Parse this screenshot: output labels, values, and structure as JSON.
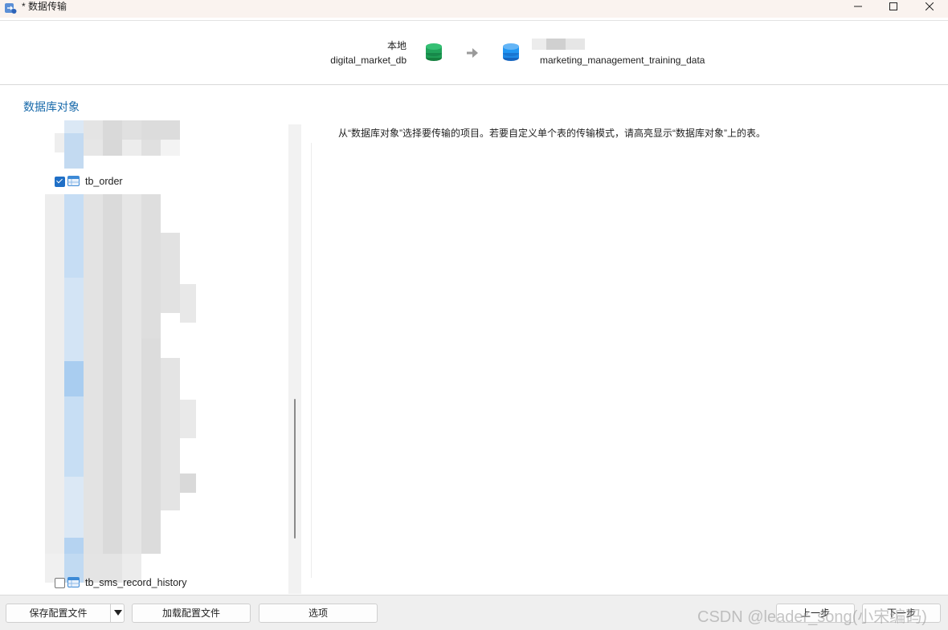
{
  "window": {
    "title": "* 数据传输",
    "app_icon": "navicat-transfer-icon",
    "controls": [
      "minimize-icon",
      "maximize-icon",
      "close-icon"
    ]
  },
  "connection": {
    "source_name": "本地",
    "source_database": "digital_market_db",
    "arrow_icon": "arrow-right-icon",
    "target_database": "marketing_management_training_data",
    "source_color": "#1f9d55",
    "target_color": "#1e88e5"
  },
  "object_tree": {
    "heading": "数据库对象",
    "items": [
      {
        "label": "tb_order",
        "checked": true
      },
      {
        "label": "tb_sms_record_history",
        "checked": false
      }
    ]
  },
  "hint_text": "从“数据库对象”选择要传输的项目。若要自定义单个表的传输模式，请高亮显示“数据库对象”上的表。",
  "buttons": {
    "save_config": "保存配置文件",
    "load_config": "加载配置文件",
    "options": "选项",
    "prev": "上一步",
    "next": "下一步"
  },
  "watermark": "CSDN @leader_song(小宋编码)"
}
